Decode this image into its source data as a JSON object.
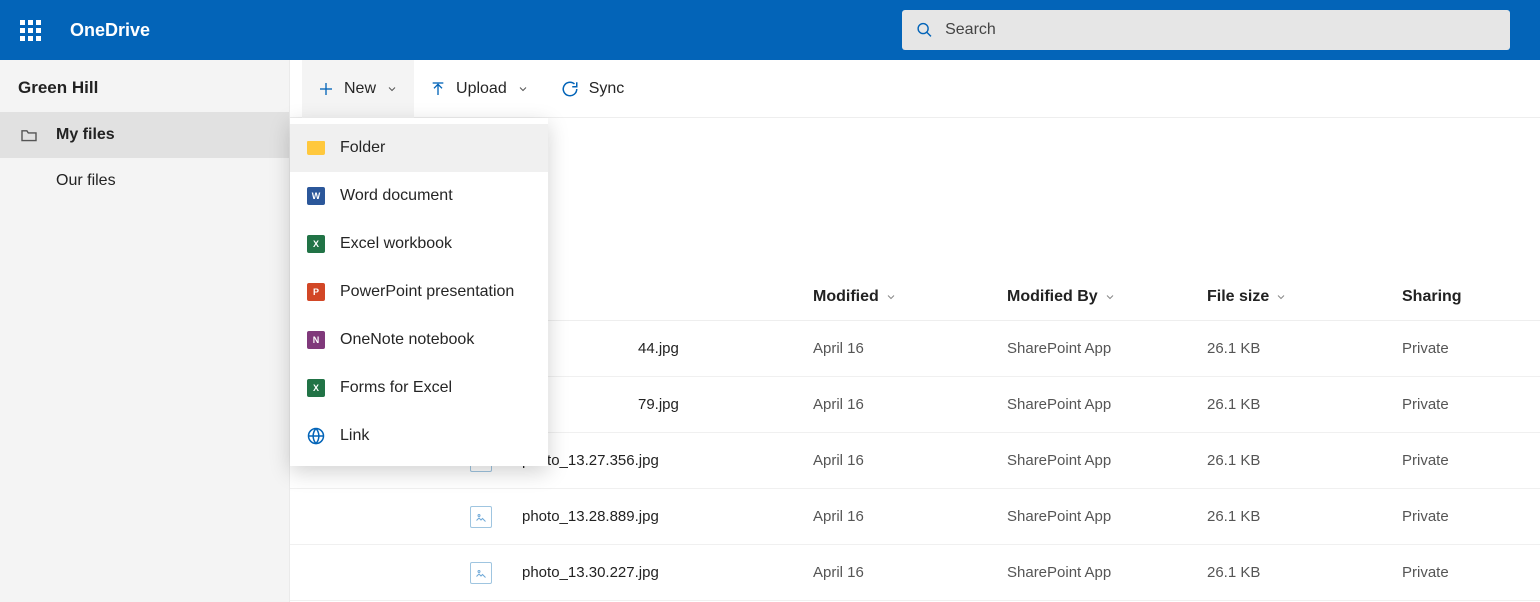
{
  "header": {
    "app_name": "OneDrive",
    "search_placeholder": "Search"
  },
  "sidebar": {
    "tenant": "Green Hill",
    "items": [
      {
        "label": "My files",
        "selected": true
      },
      {
        "label": "Our files",
        "selected": false
      }
    ]
  },
  "toolbar": {
    "new_label": "New",
    "upload_label": "Upload",
    "sync_label": "Sync"
  },
  "new_menu": {
    "items": [
      {
        "label": "Folder",
        "icon": "folder"
      },
      {
        "label": "Word document",
        "icon": "word"
      },
      {
        "label": "Excel workbook",
        "icon": "excel"
      },
      {
        "label": "PowerPoint presentation",
        "icon": "ppt"
      },
      {
        "label": "OneNote notebook",
        "icon": "onenote"
      },
      {
        "label": "Forms for Excel",
        "icon": "excel"
      },
      {
        "label": "Link",
        "icon": "link"
      }
    ]
  },
  "columns": {
    "modified": "Modified",
    "modified_by": "Modified By",
    "file_size": "File size",
    "sharing": "Sharing"
  },
  "files": [
    {
      "name_suffix": "44.jpg",
      "modified": "April 16",
      "modified_by": "SharePoint App",
      "size": "26.1 KB",
      "sharing": "Private"
    },
    {
      "name_suffix": "79.jpg",
      "modified": "April 16",
      "modified_by": "SharePoint App",
      "size": "26.1 KB",
      "sharing": "Private"
    },
    {
      "name": "photo_13.27.356.jpg",
      "modified": "April 16",
      "modified_by": "SharePoint App",
      "size": "26.1 KB",
      "sharing": "Private"
    },
    {
      "name": "photo_13.28.889.jpg",
      "modified": "April 16",
      "modified_by": "SharePoint App",
      "size": "26.1 KB",
      "sharing": "Private"
    },
    {
      "name": "photo_13.30.227.jpg",
      "modified": "April 16",
      "modified_by": "SharePoint App",
      "size": "26.1 KB",
      "sharing": "Private"
    }
  ]
}
